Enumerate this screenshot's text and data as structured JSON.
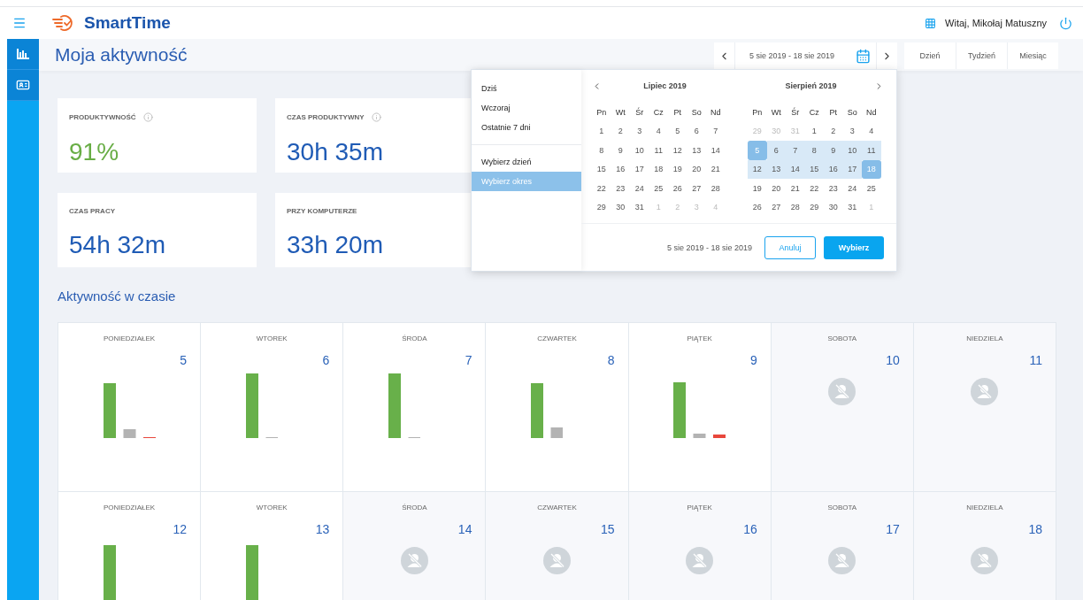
{
  "header": {
    "brand": "SmartTime",
    "greeting": "Witaj, Mikołaj Matuszny"
  },
  "page": {
    "title": "Moja aktywność"
  },
  "date_range": {
    "label": "5 sie 2019 - 18 sie 2019"
  },
  "view_buttons": [
    "Dzień",
    "Tydzień",
    "Miesiąc"
  ],
  "picker": {
    "preset_groups": [
      {
        "items": [
          {
            "label": "Dziś",
            "selected": false
          },
          {
            "label": "Wczoraj",
            "selected": false
          },
          {
            "label": "Ostatnie 7 dni",
            "selected": false
          }
        ]
      },
      {
        "items": [
          {
            "label": "Wybierz dzień",
            "selected": false
          },
          {
            "label": "Wybierz okres",
            "selected": true
          }
        ]
      }
    ],
    "months": [
      {
        "title": "Lipiec 2019",
        "weekdays": [
          "Pn",
          "Wt",
          "Śr",
          "Cz",
          "Pt",
          "So",
          "Nd"
        ],
        "days": [
          {
            "label": "1",
            "muted": false,
            "in_range": false,
            "selected": false
          },
          {
            "label": "2",
            "muted": false,
            "in_range": false,
            "selected": false
          },
          {
            "label": "3",
            "muted": false,
            "in_range": false,
            "selected": false
          },
          {
            "label": "4",
            "muted": false,
            "in_range": false,
            "selected": false
          },
          {
            "label": "5",
            "muted": false,
            "in_range": false,
            "selected": false
          },
          {
            "label": "6",
            "muted": false,
            "in_range": false,
            "selected": false
          },
          {
            "label": "7",
            "muted": false,
            "in_range": false,
            "selected": false
          },
          {
            "label": "8",
            "muted": false,
            "in_range": false,
            "selected": false
          },
          {
            "label": "9",
            "muted": false,
            "in_range": false,
            "selected": false
          },
          {
            "label": "10",
            "muted": false,
            "in_range": false,
            "selected": false
          },
          {
            "label": "11",
            "muted": false,
            "in_range": false,
            "selected": false
          },
          {
            "label": "12",
            "muted": false,
            "in_range": false,
            "selected": false
          },
          {
            "label": "13",
            "muted": false,
            "in_range": false,
            "selected": false
          },
          {
            "label": "14",
            "muted": false,
            "in_range": false,
            "selected": false
          },
          {
            "label": "15",
            "muted": false,
            "in_range": false,
            "selected": false
          },
          {
            "label": "16",
            "muted": false,
            "in_range": false,
            "selected": false
          },
          {
            "label": "17",
            "muted": false,
            "in_range": false,
            "selected": false
          },
          {
            "label": "18",
            "muted": false,
            "in_range": false,
            "selected": false
          },
          {
            "label": "19",
            "muted": false,
            "in_range": false,
            "selected": false
          },
          {
            "label": "20",
            "muted": false,
            "in_range": false,
            "selected": false
          },
          {
            "label": "21",
            "muted": false,
            "in_range": false,
            "selected": false
          },
          {
            "label": "22",
            "muted": false,
            "in_range": false,
            "selected": false
          },
          {
            "label": "23",
            "muted": false,
            "in_range": false,
            "selected": false
          },
          {
            "label": "24",
            "muted": false,
            "in_range": false,
            "selected": false
          },
          {
            "label": "25",
            "muted": false,
            "in_range": false,
            "selected": false
          },
          {
            "label": "26",
            "muted": false,
            "in_range": false,
            "selected": false
          },
          {
            "label": "27",
            "muted": false,
            "in_range": false,
            "selected": false
          },
          {
            "label": "28",
            "muted": false,
            "in_range": false,
            "selected": false
          },
          {
            "label": "29",
            "muted": false,
            "in_range": false,
            "selected": false
          },
          {
            "label": "30",
            "muted": false,
            "in_range": false,
            "selected": false
          },
          {
            "label": "31",
            "muted": false,
            "in_range": false,
            "selected": false
          },
          {
            "label": "1",
            "muted": true,
            "in_range": false,
            "selected": false
          },
          {
            "label": "2",
            "muted": true,
            "in_range": false,
            "selected": false
          },
          {
            "label": "3",
            "muted": true,
            "in_range": false,
            "selected": false
          },
          {
            "label": "4",
            "muted": true,
            "in_range": false,
            "selected": false
          }
        ]
      },
      {
        "title": "Sierpień 2019",
        "weekdays": [
          "Pn",
          "Wt",
          "Śr",
          "Cz",
          "Pt",
          "So",
          "Nd"
        ],
        "days": [
          {
            "label": "29",
            "muted": true,
            "in_range": false,
            "selected": false
          },
          {
            "label": "30",
            "muted": true,
            "in_range": false,
            "selected": false
          },
          {
            "label": "31",
            "muted": true,
            "in_range": false,
            "selected": false
          },
          {
            "label": "1",
            "muted": false,
            "in_range": false,
            "selected": false
          },
          {
            "label": "2",
            "muted": false,
            "in_range": false,
            "selected": false
          },
          {
            "label": "3",
            "muted": false,
            "in_range": false,
            "selected": false
          },
          {
            "label": "4",
            "muted": false,
            "in_range": false,
            "selected": false
          },
          {
            "label": "5",
            "muted": false,
            "in_range": true,
            "selected": true
          },
          {
            "label": "6",
            "muted": false,
            "in_range": true,
            "selected": false
          },
          {
            "label": "7",
            "muted": false,
            "in_range": true,
            "selected": false
          },
          {
            "label": "8",
            "muted": false,
            "in_range": true,
            "selected": false
          },
          {
            "label": "9",
            "muted": false,
            "in_range": true,
            "selected": false
          },
          {
            "label": "10",
            "muted": false,
            "in_range": true,
            "selected": false
          },
          {
            "label": "11",
            "muted": false,
            "in_range": true,
            "selected": false
          },
          {
            "label": "12",
            "muted": false,
            "in_range": true,
            "selected": false
          },
          {
            "label": "13",
            "muted": false,
            "in_range": true,
            "selected": false
          },
          {
            "label": "14",
            "muted": false,
            "in_range": true,
            "selected": false
          },
          {
            "label": "15",
            "muted": false,
            "in_range": true,
            "selected": false
          },
          {
            "label": "16",
            "muted": false,
            "in_range": true,
            "selected": false
          },
          {
            "label": "17",
            "muted": false,
            "in_range": true,
            "selected": false
          },
          {
            "label": "18",
            "muted": false,
            "in_range": true,
            "selected": true
          },
          {
            "label": "19",
            "muted": false,
            "in_range": false,
            "selected": false
          },
          {
            "label": "20",
            "muted": false,
            "in_range": false,
            "selected": false
          },
          {
            "label": "21",
            "muted": false,
            "in_range": false,
            "selected": false
          },
          {
            "label": "22",
            "muted": false,
            "in_range": false,
            "selected": false
          },
          {
            "label": "23",
            "muted": false,
            "in_range": false,
            "selected": false
          },
          {
            "label": "24",
            "muted": false,
            "in_range": false,
            "selected": false
          },
          {
            "label": "25",
            "muted": false,
            "in_range": false,
            "selected": false
          },
          {
            "label": "26",
            "muted": false,
            "in_range": false,
            "selected": false
          },
          {
            "label": "27",
            "muted": false,
            "in_range": false,
            "selected": false
          },
          {
            "label": "28",
            "muted": false,
            "in_range": false,
            "selected": false
          },
          {
            "label": "29",
            "muted": false,
            "in_range": false,
            "selected": false
          },
          {
            "label": "30",
            "muted": false,
            "in_range": false,
            "selected": false
          },
          {
            "label": "31",
            "muted": false,
            "in_range": false,
            "selected": false
          },
          {
            "label": "1",
            "muted": true,
            "in_range": false,
            "selected": false
          }
        ]
      }
    ],
    "footer_range": "5 sie 2019 - 18 sie 2019",
    "cancel": "Anuluj",
    "confirm": "Wybierz"
  },
  "stats": [
    {
      "label": "PRODUKTYWNOŚĆ",
      "value": "91%",
      "kind": "percent",
      "info": true
    },
    {
      "label": "CZAS PRODUKTYWNY",
      "value": "30h 35m",
      "kind": "time",
      "info": true
    },
    {
      "label": "CZAS PRACY",
      "value": "54h 32m",
      "kind": "time",
      "info": false
    },
    {
      "label": "PRZY KOMPUTERZE",
      "value": "33h 20m",
      "kind": "time",
      "info": false
    }
  ],
  "activity": {
    "title": "Aktywność w czasie",
    "days": [
      {
        "weekday": "PONIEDZIAŁEK",
        "date": "5",
        "kind": "work"
      },
      {
        "weekday": "WTOREK",
        "date": "6",
        "kind": "work"
      },
      {
        "weekday": "ŚRODA",
        "date": "7",
        "kind": "work"
      },
      {
        "weekday": "CZWARTEK",
        "date": "8",
        "kind": "work"
      },
      {
        "weekday": "PIĄTEK",
        "date": "9",
        "kind": "work"
      },
      {
        "weekday": "SOBOTA",
        "date": "10",
        "kind": "empty"
      },
      {
        "weekday": "NIEDZIELA",
        "date": "11",
        "kind": "empty"
      },
      {
        "weekday": "PONIEDZIAŁEK",
        "date": "12",
        "kind": "work"
      },
      {
        "weekday": "WTOREK",
        "date": "13",
        "kind": "work"
      },
      {
        "weekday": "ŚRODA",
        "date": "14",
        "kind": "empty"
      },
      {
        "weekday": "CZWARTEK",
        "date": "15",
        "kind": "empty"
      },
      {
        "weekday": "PIĄTEK",
        "date": "16",
        "kind": "empty"
      },
      {
        "weekday": "SOBOTA",
        "date": "17",
        "kind": "empty"
      },
      {
        "weekday": "NIEDZIELA",
        "date": "18",
        "kind": "empty"
      }
    ]
  }
}
